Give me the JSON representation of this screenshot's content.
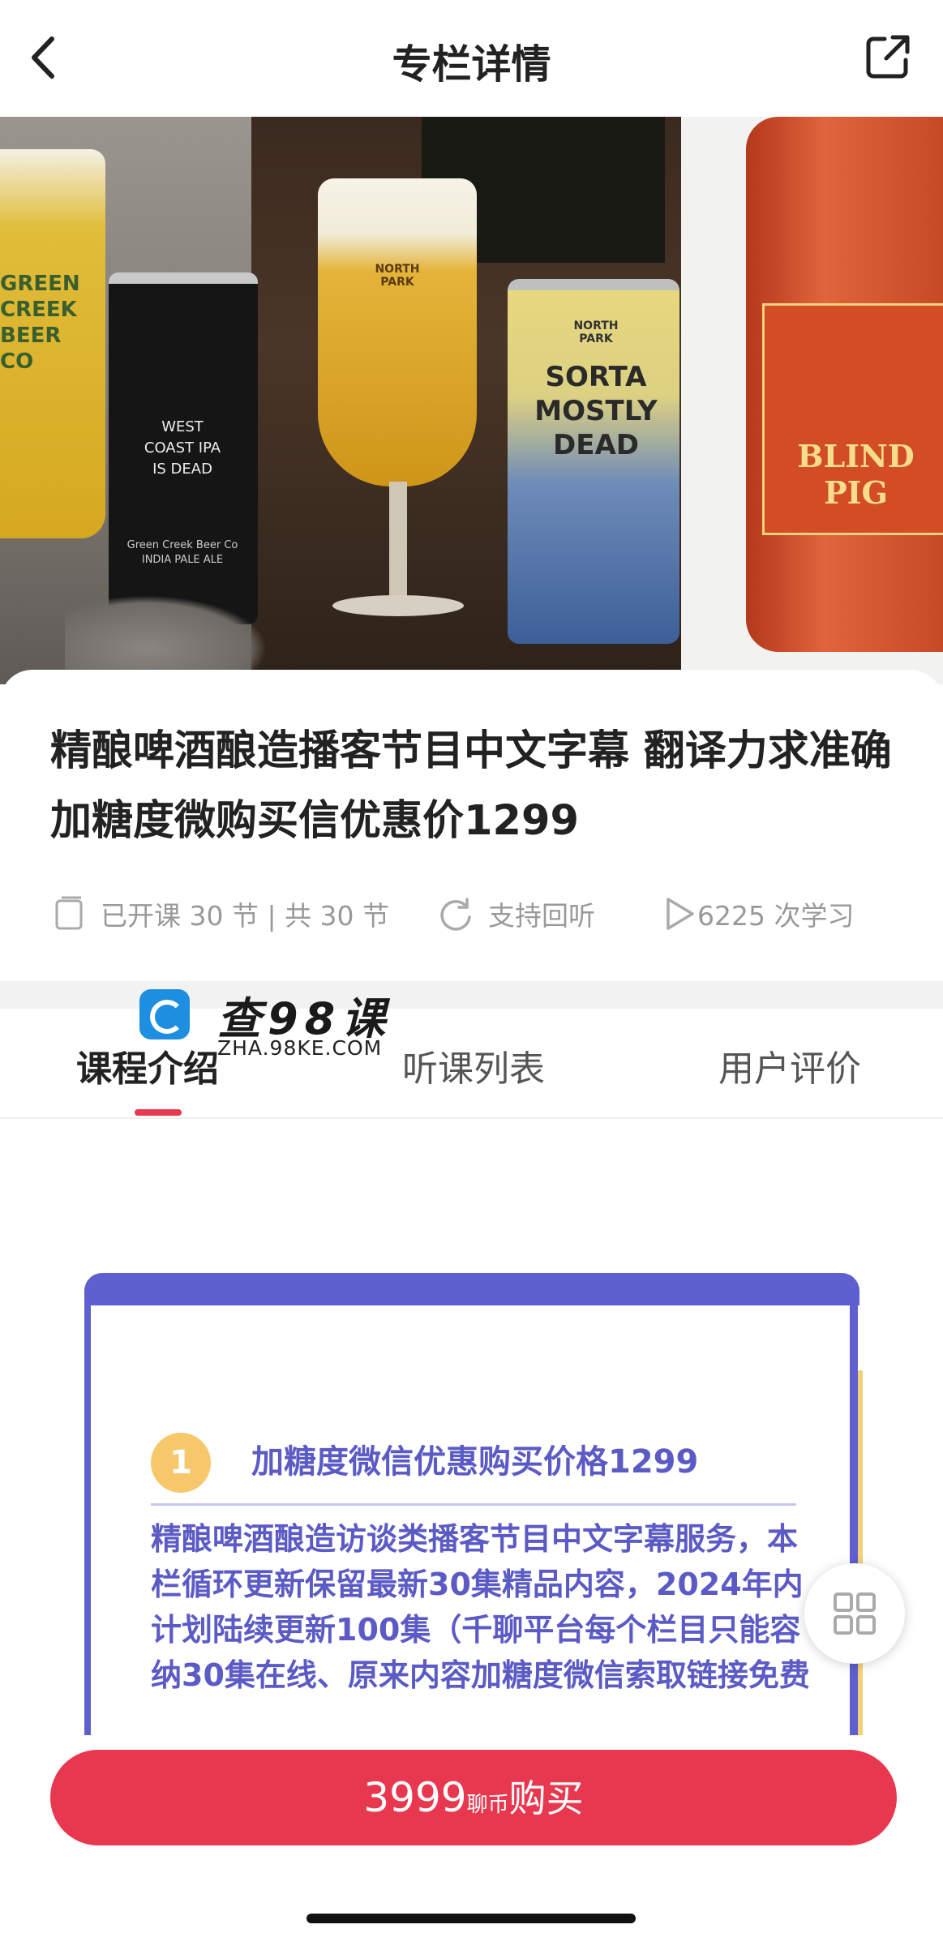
{
  "header": {
    "title": "专栏详情"
  },
  "banner": {
    "can1_text": "GREEN CREEK BEER CO",
    "can2_text": "WEST COAST IPA IS DEAD",
    "can2_brand": "Green Creek Beer Co INDIA PALE ALE",
    "glass_logo": "NORTH PARK",
    "can3_brand": "NORTH PARK",
    "can3_text": "SORTA MOSTLY DEAD",
    "bottle_text": "BLIND PIG"
  },
  "course": {
    "title": "精酿啤酒酿造播客节目中文字幕 翻译力求准确 加糖度微购买信优惠价1299",
    "lessons": "已开课 30 节 | 共 30 节",
    "replay": "支持回听",
    "views": "6225 次学习"
  },
  "watermark": {
    "text": "查98课",
    "sub": "ZHA.98KE.COM"
  },
  "tabs": [
    {
      "label": "课程介绍"
    },
    {
      "label": "听课列表"
    },
    {
      "label": "用户评价"
    }
  ],
  "intro": {
    "step_number": "1",
    "step_title": "加糖度微信优惠购买价格1299",
    "step_body": "精酿啤酒酿造访谈类播客节目中文字幕服务，本栏循环更新保留最新30集精品内容，2024年内计划陆续更新100集（千聊平台每个栏目只能容纳30集在线、原来内容加糖度微信索取链接免费"
  },
  "buy": {
    "price": "3999",
    "unit": "聊币",
    "action": "购买"
  },
  "colors": {
    "accent": "#e8384f",
    "intro_purple": "#5c5bc6"
  }
}
